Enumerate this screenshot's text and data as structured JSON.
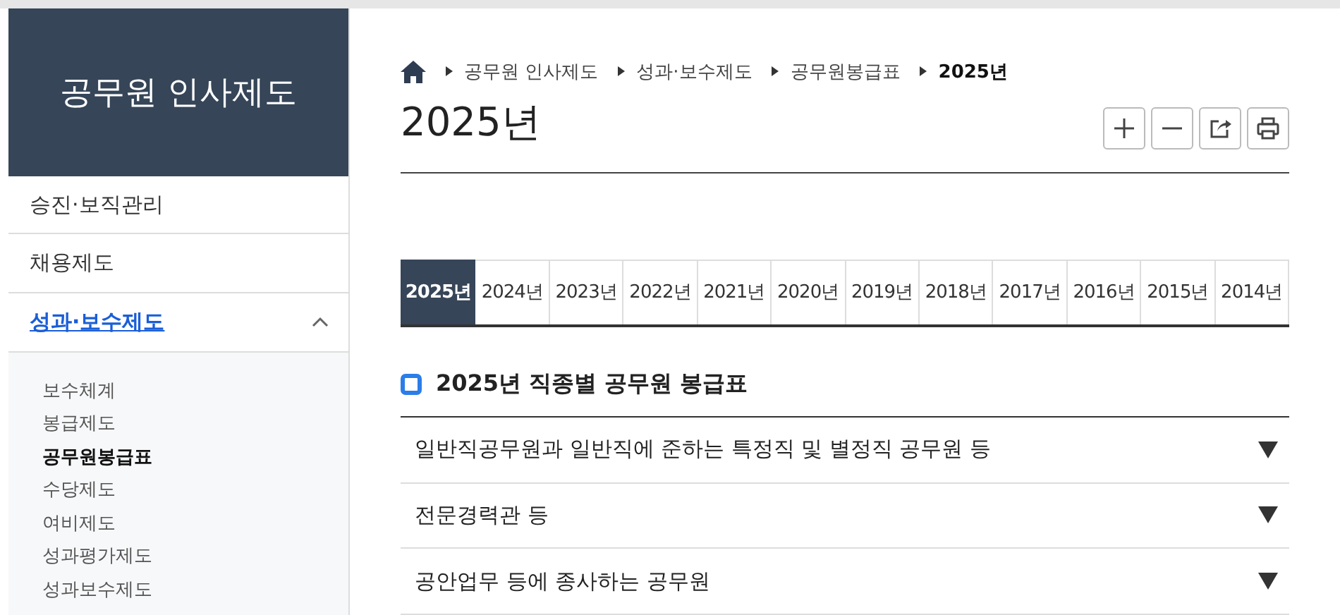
{
  "sidebar": {
    "title": "공무원 인사제도",
    "items": [
      {
        "label": "승진·보직관리",
        "selected": false,
        "expanded": false
      },
      {
        "label": "채용제도",
        "selected": false,
        "expanded": false
      },
      {
        "label": "성과·보수제도",
        "selected": true,
        "expanded": true,
        "children": [
          {
            "label": "보수체계",
            "selected": false
          },
          {
            "label": "봉급제도",
            "selected": false
          },
          {
            "label": "공무원봉급표",
            "selected": true
          },
          {
            "label": "수당제도",
            "selected": false
          },
          {
            "label": "여비제도",
            "selected": false
          },
          {
            "label": "성과평가제도",
            "selected": false
          },
          {
            "label": "성과보수제도",
            "selected": false
          }
        ]
      }
    ]
  },
  "breadcrumb": [
    "공무원 인사제도",
    "성과·보수제도",
    "공무원봉급표",
    "2025년"
  ],
  "page_title": "2025년",
  "year_tabs": [
    {
      "label": "2025년",
      "selected": true
    },
    {
      "label": "2024년",
      "selected": false
    },
    {
      "label": "2023년",
      "selected": false
    },
    {
      "label": "2022년",
      "selected": false
    },
    {
      "label": "2021년",
      "selected": false
    },
    {
      "label": "2020년",
      "selected": false
    },
    {
      "label": "2019년",
      "selected": false
    },
    {
      "label": "2018년",
      "selected": false
    },
    {
      "label": "2017년",
      "selected": false
    },
    {
      "label": "2016년",
      "selected": false
    },
    {
      "label": "2015년",
      "selected": false
    },
    {
      "label": "2014년",
      "selected": false
    }
  ],
  "section": {
    "title": "2025년 직종별 공무원 봉급표",
    "accordion": [
      {
        "label": "일반직공무원과 일반직에 준하는 특정직 및 별정직 공무원 등",
        "expanded": false
      },
      {
        "label": "전문경력관 등",
        "expanded": false
      },
      {
        "label": "공안업무 등에 종사하는 공무원",
        "expanded": false
      }
    ]
  }
}
